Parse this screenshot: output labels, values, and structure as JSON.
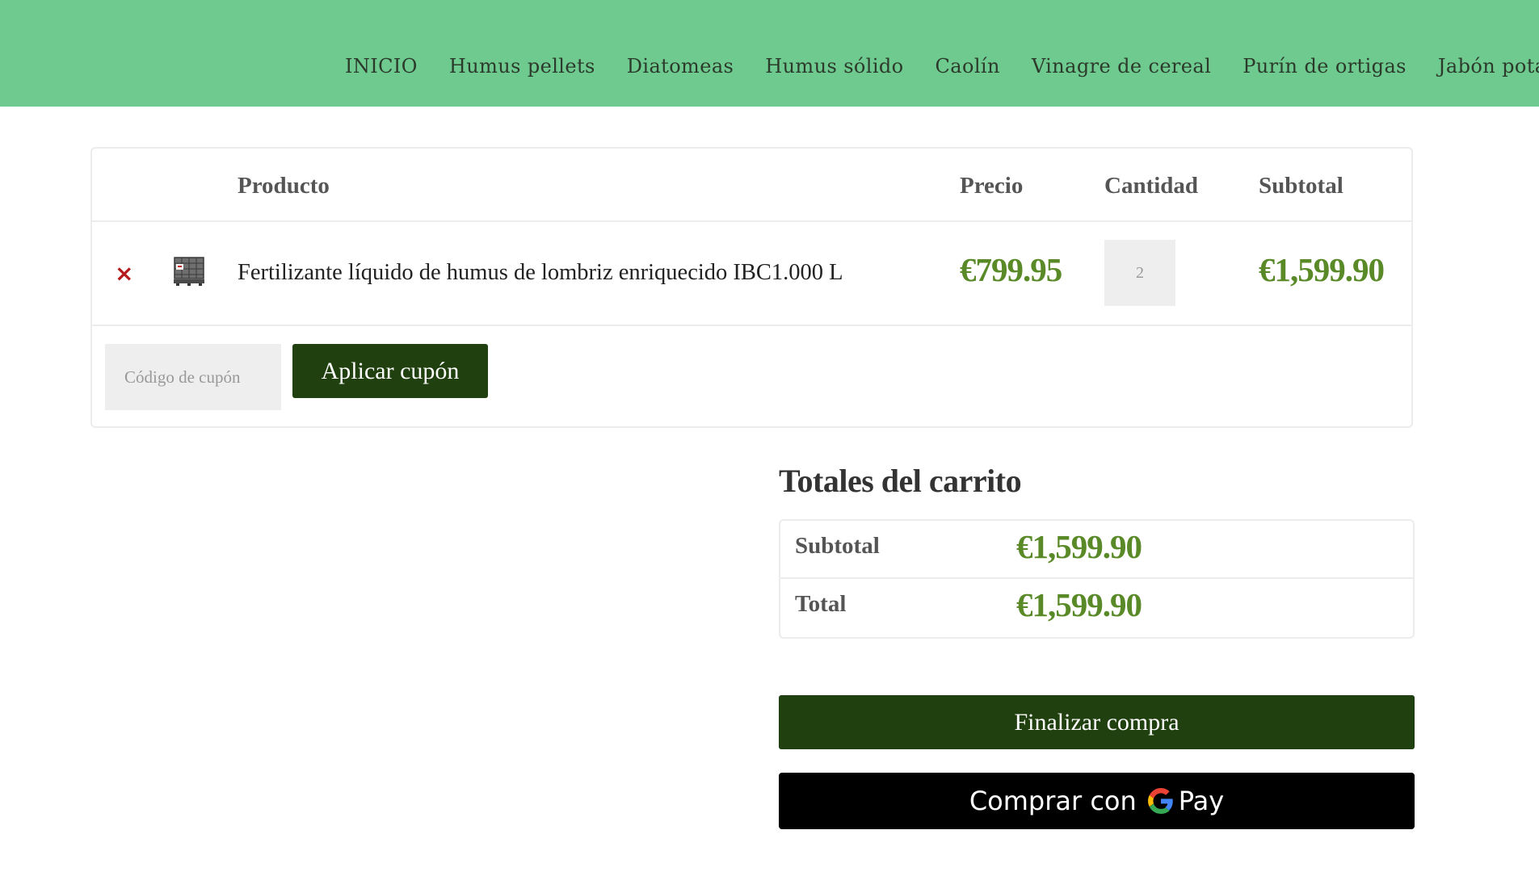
{
  "nav": {
    "items": [
      "INICIO",
      "Humus pellets",
      "Diatomeas",
      "Humus sólido",
      "Caolín",
      "Vinagre de cereal",
      "Purín de ortigas",
      "Jabón potás"
    ]
  },
  "cart": {
    "headers": {
      "product": "Producto",
      "price": "Precio",
      "quantity": "Cantidad",
      "subtotal": "Subtotal"
    },
    "item": {
      "remove_icon": "remove-x-icon",
      "remove_glyph": "×",
      "name": "Fertilizante líquido de humus de lombriz enriquecido IBC1.000 L",
      "price": "€799.95",
      "quantity": "2",
      "subtotal": "€1,599.90"
    },
    "coupon": {
      "placeholder": "Código de cupón",
      "button_label": "Aplicar cupón"
    }
  },
  "totals": {
    "title": "Totales del carrito",
    "subtotal_label": "Subtotal",
    "subtotal_value": "€1,599.90",
    "total_label": "Total",
    "total_value": "€1,599.90"
  },
  "actions": {
    "checkout_label": "Finalizar compra",
    "gpay_prefix": "Comprar con",
    "gpay_suffix": "Pay"
  },
  "colors": {
    "header_bg": "#6fca8f",
    "button_green": "#20410f",
    "price_green": "#5a8a28",
    "remove_red": "#b51b1b",
    "gpay_bg": "#000000"
  }
}
